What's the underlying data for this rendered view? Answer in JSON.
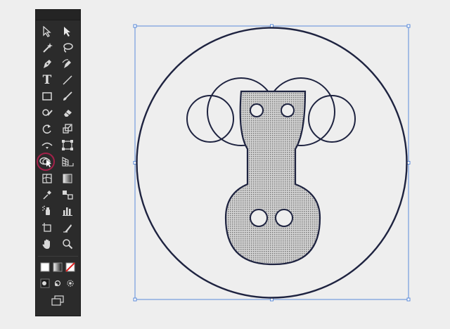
{
  "toolbar": {
    "title": "",
    "selected_tool": "shape-builder-tool",
    "tools": [
      {
        "name": "selection-tool",
        "icon": "arrow-black-icon"
      },
      {
        "name": "direct-selection-tool",
        "icon": "arrow-white-icon"
      },
      {
        "name": "magic-wand-tool",
        "icon": "magic-wand-icon"
      },
      {
        "name": "lasso-tool",
        "icon": "lasso-icon"
      },
      {
        "name": "pen-tool",
        "icon": "pen-icon"
      },
      {
        "name": "curvature-tool",
        "icon": "curvature-pen-icon"
      },
      {
        "name": "type-tool",
        "icon": "type-t-icon",
        "glyph": "T"
      },
      {
        "name": "line-segment-tool",
        "icon": "line-icon"
      },
      {
        "name": "rectangle-tool",
        "icon": "rectangle-icon"
      },
      {
        "name": "paintbrush-tool",
        "icon": "paintbrush-icon"
      },
      {
        "name": "shaper-tool",
        "icon": "shaper-icon"
      },
      {
        "name": "eraser-tool",
        "icon": "eraser-icon"
      },
      {
        "name": "rotate-tool",
        "icon": "rotate-icon"
      },
      {
        "name": "scale-tool",
        "icon": "scale-icon"
      },
      {
        "name": "width-tool",
        "icon": "width-icon"
      },
      {
        "name": "free-transform-tool",
        "icon": "free-transform-icon"
      },
      {
        "name": "shape-builder-tool",
        "icon": "shape-builder-icon"
      },
      {
        "name": "perspective-grid-tool",
        "icon": "perspective-grid-icon"
      },
      {
        "name": "mesh-tool",
        "icon": "mesh-icon"
      },
      {
        "name": "gradient-tool",
        "icon": "gradient-icon"
      },
      {
        "name": "eyedropper-tool",
        "icon": "eyedropper-icon"
      },
      {
        "name": "blend-tool",
        "icon": "blend-icon"
      },
      {
        "name": "symbol-sprayer-tool",
        "icon": "symbol-sprayer-icon"
      },
      {
        "name": "column-graph-tool",
        "icon": "column-graph-icon"
      },
      {
        "name": "artboard-tool",
        "icon": "artboard-icon"
      },
      {
        "name": "slice-tool",
        "icon": "slice-icon"
      },
      {
        "name": "hand-tool",
        "icon": "hand-icon"
      },
      {
        "name": "zoom-tool",
        "icon": "zoom-icon"
      }
    ],
    "fill_color": "#ffffff",
    "stroke_color": "#1c1c1c",
    "accent_ring_color": "#a3214a"
  },
  "canvas": {
    "artwork": "shape-builder-robot-face",
    "stroke_color": "#1e2340",
    "fill_color": "#c8c8c8",
    "selection_color": "#5b8bd9"
  }
}
